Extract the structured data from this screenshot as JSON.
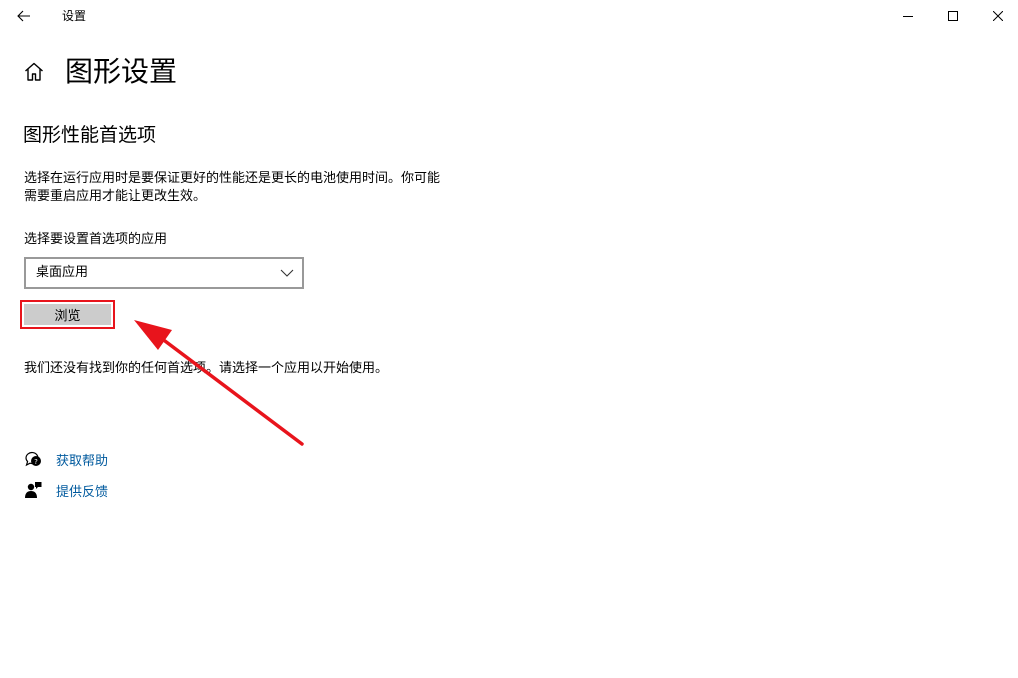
{
  "window": {
    "title": "设置",
    "back_icon": "back-arrow-icon",
    "controls": [
      "minimize-icon",
      "maximize-icon",
      "close-icon"
    ]
  },
  "page": {
    "title": "图形设置",
    "home_icon": "home-icon"
  },
  "section": {
    "title": "图形性能首选项",
    "description_line1": "选择在运行应用时是要保证更好的性能还是更长的电池使用时间。你可能",
    "description_line2": "需要重启应用才能让更改生效。"
  },
  "app_selector": {
    "label": "选择要设置首选项的应用",
    "value": "桌面应用"
  },
  "browse_button": {
    "label": "浏览"
  },
  "empty_message": "我们还没有找到你的任何首选项。请选择一个应用以开始使用。",
  "links": {
    "help": "获取帮助",
    "feedback": "提供反馈"
  },
  "colors": {
    "link": "#005a9e",
    "button_bg": "#cccccc",
    "annotation_red": "#e8141c",
    "select_border": "#999999"
  }
}
